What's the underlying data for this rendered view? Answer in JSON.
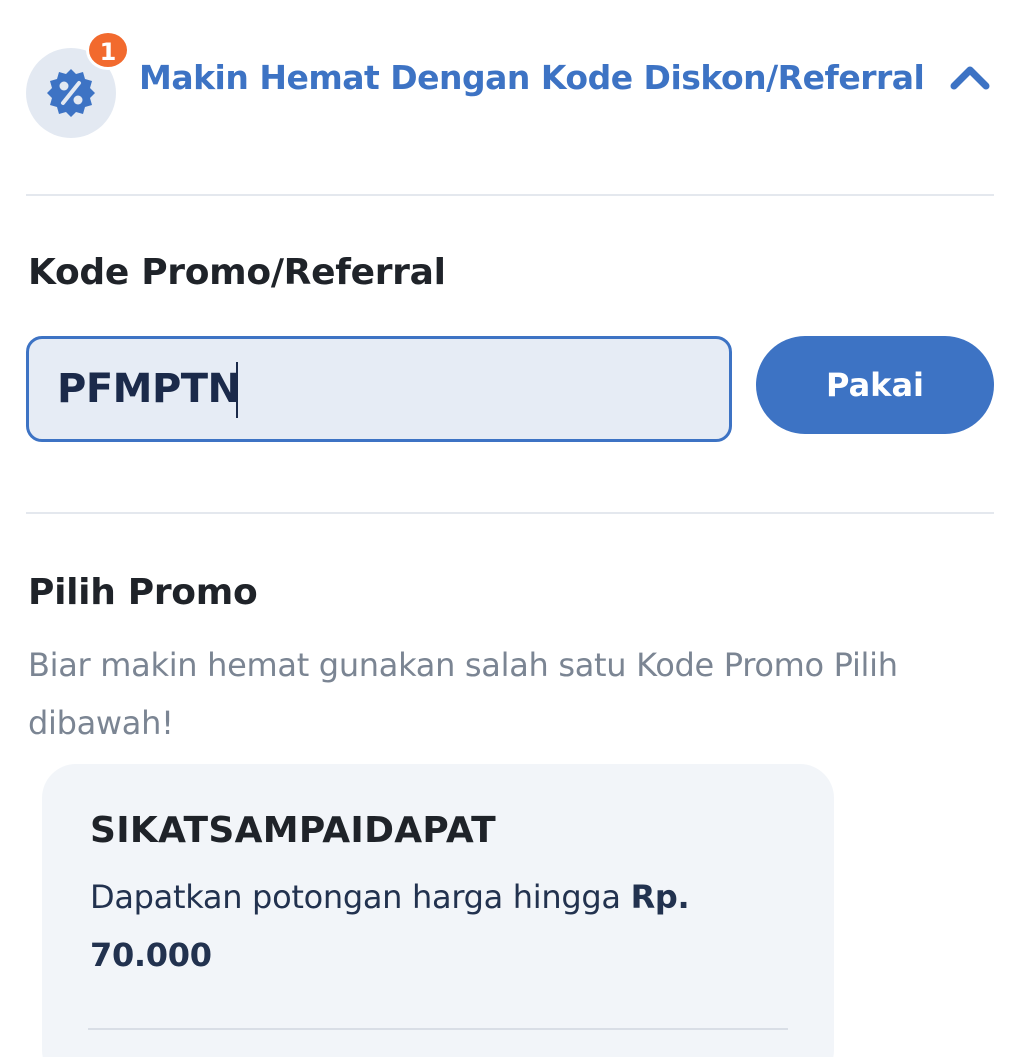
{
  "header": {
    "title": "Makin Hemat Dengan Kode Diskon/Referral",
    "badge_count": "1",
    "icon": "discount-badge-icon",
    "toggle_icon": "chevron-up-icon"
  },
  "promo_code": {
    "label": "Kode Promo/Referral",
    "value": "PFMPTN",
    "apply_label": "Pakai"
  },
  "choose_promo": {
    "title": "Pilih Promo",
    "description": "Biar makin hemat gunakan salah satu Kode Promo Pilih dibawah!"
  },
  "promos": [
    {
      "code": "SIKATSAMPAIDAPAT",
      "desc_prefix": "Dapatkan potongan harga hingga ",
      "amount": "Rp. 70.000"
    }
  ],
  "colors": {
    "primary": "#3d73c4",
    "badge": "#f26a2e",
    "text_dark": "#1f2329",
    "text_muted": "#7b8593",
    "card_bg": "#f2f5f9"
  }
}
